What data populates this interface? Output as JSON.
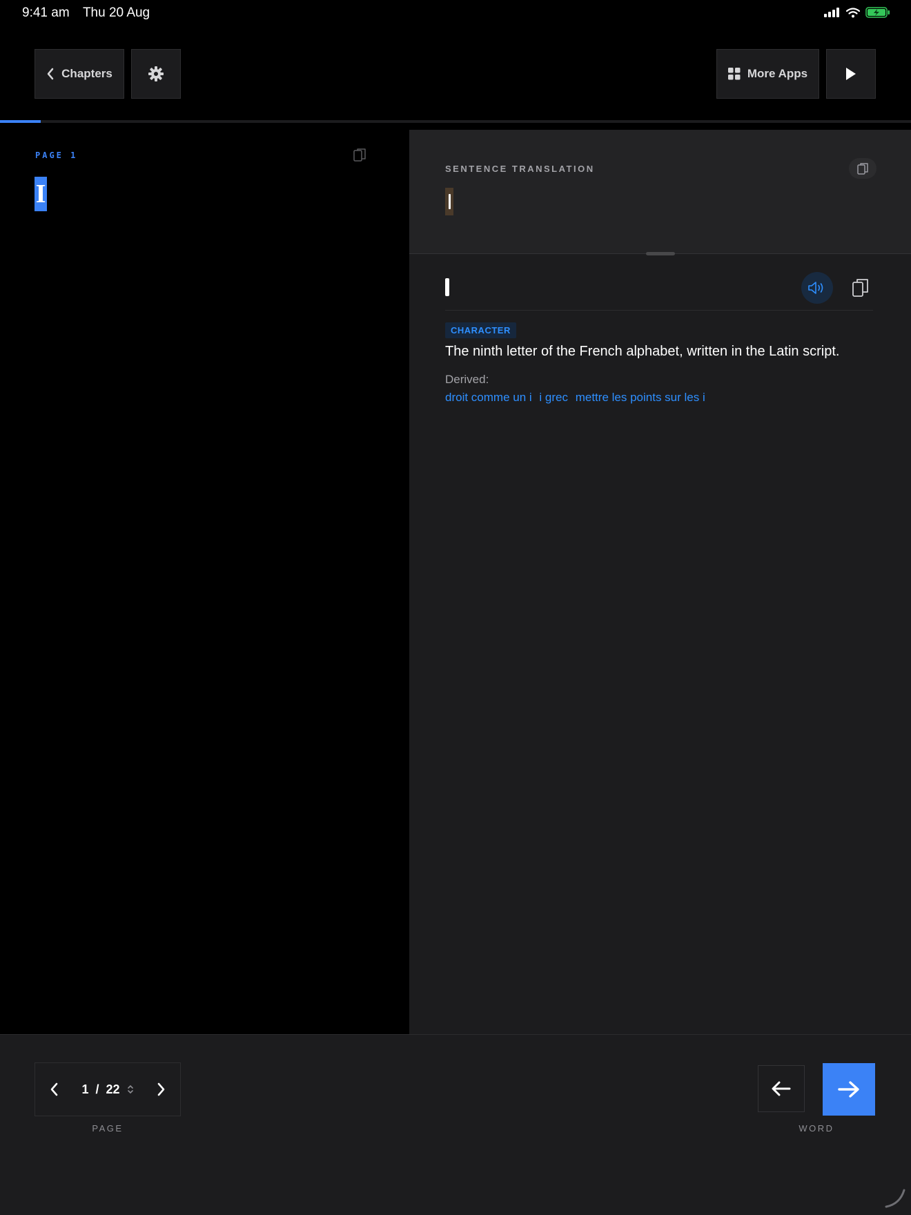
{
  "status_bar": {
    "time": "9:41 am",
    "date": "Thu 20 Aug",
    "battery_color": "#34c759"
  },
  "toolbar": {
    "chapters_label": "Chapters",
    "more_apps_label": "More Apps"
  },
  "reading_progress": 0.045,
  "page_view": {
    "page_label": "PAGE 1",
    "token": "I"
  },
  "translation": {
    "label": "SENTENCE TRANSLATION"
  },
  "entry": {
    "part_of_speech": "CHARACTER",
    "definition": "The ninth letter of the French alphabet, written in the Latin script.",
    "derived_label": "Derived:",
    "derived": [
      "droit comme un i",
      "i grec",
      "mettre les points sur les i"
    ]
  },
  "pagination": {
    "current": "1",
    "separator": "/",
    "total": "22",
    "label": "PAGE"
  },
  "word_nav": {
    "label": "WORD"
  },
  "colors": {
    "accent": "#3b82f6",
    "link": "#2e8fff",
    "panel": "#1c1c1e"
  }
}
